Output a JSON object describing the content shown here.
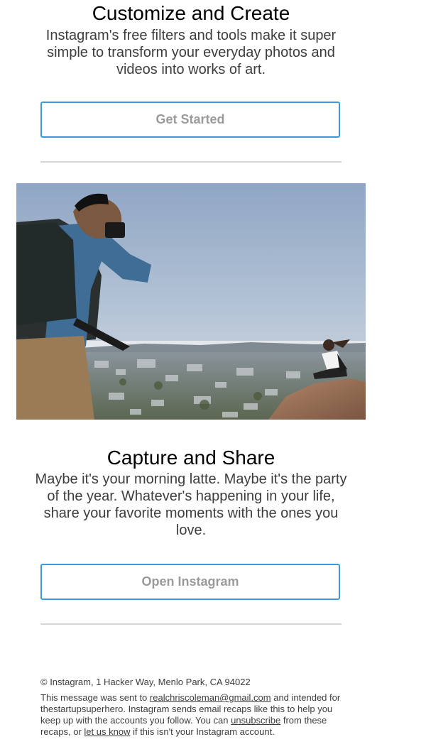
{
  "section1": {
    "title": "Customize and Create",
    "body": "Instagram's free filters and tools make it super simple to transform your everyday photos and videos into works of art.",
    "button_label": "Get Started"
  },
  "hero_image": {
    "description_icon": "photo"
  },
  "section2": {
    "title": "Capture and Share",
    "body": "Maybe it's your morning latte. Maybe it's the party of the year. Whatever's happening in your life, share your favorite moments with the ones you love.",
    "button_label": "Open Instagram"
  },
  "footer": {
    "copyright": "© Instagram, 1 Hacker Way, Menlo Park, CA 94022",
    "line_part1": "This message was sent to ",
    "email": "realchriscoleman@gmail.com",
    "line_part2": " and intended for thestartupsuperhero. Instagram sends email recaps like this to help you keep up with the accounts you follow. You can ",
    "unsubscribe": "unsubscribe",
    "line_part3": " from these recaps, or ",
    "let_us_know": "let us know",
    "line_part4": " if this isn't your Instagram account."
  },
  "colors": {
    "button_border": "#3d98d9",
    "button_text": "#9b9b9b",
    "divider": "#d6d6d6"
  }
}
